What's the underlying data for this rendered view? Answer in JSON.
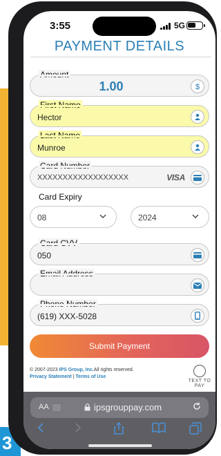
{
  "status": {
    "time": "3:55",
    "network": "5G"
  },
  "form": {
    "title": "PAYMENT DETAILS",
    "amount": {
      "label": "Amount",
      "value": "1.00"
    },
    "first_name": {
      "label": "First Name",
      "value": "Hector"
    },
    "last_name": {
      "label": "Last Name",
      "value": "Munroe"
    },
    "card_number": {
      "label": "Card Number",
      "value": "XXXXXXXXXXXXXXXXXX",
      "brand": "VISA"
    },
    "card_expiry": {
      "label": "Card Expiry",
      "month": "08",
      "year": "2024"
    },
    "card_cvv": {
      "label": "Card CVV",
      "value": "050"
    },
    "email": {
      "label": "Email Address",
      "value": ""
    },
    "phone": {
      "label": "Phone Number",
      "value": "(619) XXX-5028"
    },
    "submit_label": "Submit Payment"
  },
  "footer": {
    "copyright_prefix": "© 2007-2023 ",
    "company": "IPS Group, Inc.",
    "rights": "All rights reserved.",
    "privacy": "Privacy Statement",
    "separator": " | ",
    "terms": "Terms of Use",
    "text_to_pay": "TEXT TO PAY"
  },
  "browser": {
    "aa_label": "AA",
    "url": "ipsgrouppay.com"
  },
  "colors": {
    "brand_blue": "#2b7fb6",
    "autofill_yellow": "#fafaaa",
    "submit_start": "#f08a35",
    "submit_end": "#d85466"
  },
  "icons": [
    "dollar-icon",
    "person-icon",
    "card-icon",
    "envelope-icon",
    "phone-icon",
    "chevron-down-icon",
    "lock-icon",
    "reload-icon",
    "back-icon",
    "forward-icon",
    "share-icon",
    "bookmarks-icon",
    "tabs-icon",
    "text-to-pay-icon"
  ]
}
